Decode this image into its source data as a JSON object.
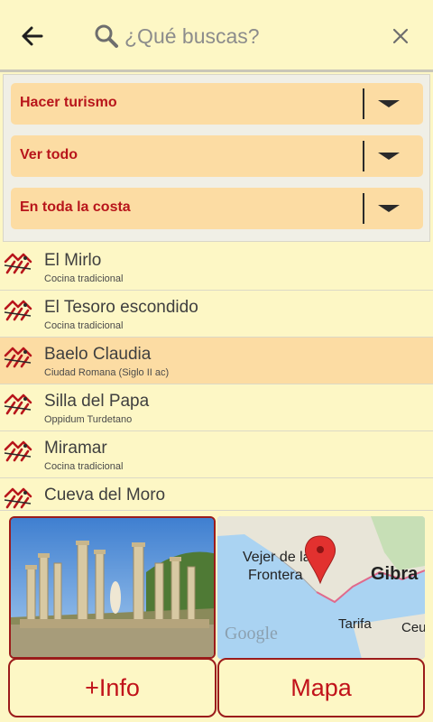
{
  "header": {
    "search_placeholder": "¿Qué buscas?",
    "back_icon": "arrow-left-icon",
    "search_icon": "magnifier-icon",
    "clear_icon": "close-icon"
  },
  "filters": [
    {
      "label": "Hacer turismo"
    },
    {
      "label": "Ver todo"
    },
    {
      "label": "En toda la costa"
    }
  ],
  "places": [
    {
      "title": "El Mirlo",
      "subtitle": "Cocina tradicional",
      "selected": false
    },
    {
      "title": "El Tesoro escondido",
      "subtitle": "Cocina tradicional",
      "selected": false
    },
    {
      "title": "Baelo Claudia",
      "subtitle": "Ciudad Romana (Siglo II ac)",
      "selected": true
    },
    {
      "title": "Silla del Papa",
      "subtitle": "Oppidum Turdetano",
      "selected": false
    },
    {
      "title": "Miramar",
      "subtitle": "Cocina tradicional",
      "selected": false
    },
    {
      "title": "Cueva del Moro",
      "subtitle": "",
      "selected": false
    }
  ],
  "map": {
    "labels": [
      "Vejer de la",
      "Frontera",
      "Gibra",
      "Tarifa",
      "Ceu",
      "Google"
    ]
  },
  "actions": {
    "info_label": "+Info",
    "map_label": "Mapa"
  },
  "colors": {
    "background": "#fdf7c5",
    "dropdown": "#fcdca3",
    "accent_red": "#c1121a",
    "selected_row": "#fcdca3"
  }
}
